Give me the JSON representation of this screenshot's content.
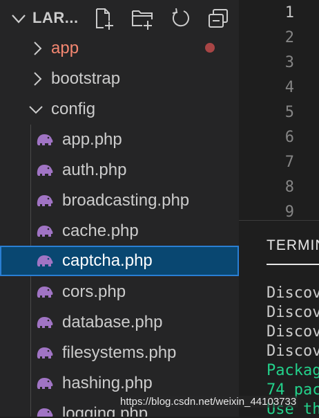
{
  "explorer": {
    "title": "LAR...",
    "actions": [
      {
        "name": "new-file-icon"
      },
      {
        "name": "new-folder-icon"
      },
      {
        "name": "refresh-icon"
      },
      {
        "name": "collapse-all-icon"
      }
    ],
    "items": [
      {
        "label": "app",
        "type": "folder",
        "expanded": false,
        "color": "#f48771",
        "modified": true
      },
      {
        "label": "bootstrap",
        "type": "folder",
        "expanded": false,
        "color": "#cccccc"
      },
      {
        "label": "config",
        "type": "folder",
        "expanded": true,
        "color": "#cccccc"
      },
      {
        "label": "app.php",
        "type": "php",
        "color": "#cccccc"
      },
      {
        "label": "auth.php",
        "type": "php",
        "color": "#cccccc"
      },
      {
        "label": "broadcasting.php",
        "type": "php",
        "color": "#cccccc"
      },
      {
        "label": "cache.php",
        "type": "php",
        "color": "#cccccc"
      },
      {
        "label": "captcha.php",
        "type": "php",
        "color": "#ffffff",
        "selected": true
      },
      {
        "label": "cors.php",
        "type": "php",
        "color": "#cccccc"
      },
      {
        "label": "database.php",
        "type": "php",
        "color": "#cccccc"
      },
      {
        "label": "filesystems.php",
        "type": "php",
        "color": "#cccccc"
      },
      {
        "label": "hashing.php",
        "type": "php",
        "color": "#cccccc"
      },
      {
        "label": "logging.php",
        "type": "php",
        "color": "#cccccc"
      }
    ]
  },
  "editor": {
    "line_numbers": [
      "1",
      "2",
      "3",
      "4",
      "5",
      "6",
      "7",
      "8",
      "9"
    ]
  },
  "panel": {
    "tab": "TERMIN",
    "lines": [
      {
        "text": "Discov",
        "color": "#cccccc"
      },
      {
        "text": "Discov",
        "color": "#cccccc"
      },
      {
        "text": "Discov",
        "color": "#cccccc"
      },
      {
        "text": "Discov",
        "color": "#cccccc"
      },
      {
        "text": "Packag",
        "color": "#23d18b"
      },
      {
        "text": "74 pac",
        "color": "#23d18b"
      },
      {
        "text": "Use th",
        "color": "#23d18b"
      }
    ]
  },
  "watermark": "https://blog.csdn.net/weixin_44103733",
  "colors": {
    "sidebar_bg": "#252526",
    "editor_bg": "#1e1e1e",
    "selection_bg": "#094771",
    "selection_border": "#2a7fd4",
    "php_icon": "#a074c4"
  }
}
